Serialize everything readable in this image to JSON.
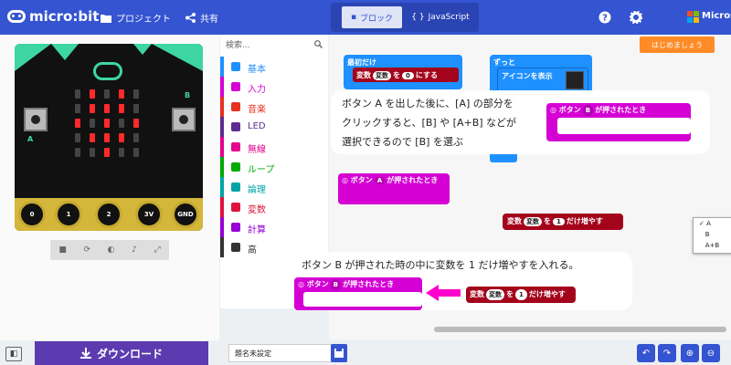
{
  "header": {
    "logo_text": "micro:bit",
    "project_label": "プロジェクト",
    "share_label": "共有",
    "blocks_label": "ブロック",
    "javascript_label": "JavaScript",
    "microsoft_label": "Microsoft",
    "colors": {
      "bar": "#3454d1"
    }
  },
  "simulator": {
    "button_a": "A",
    "button_b": "B",
    "pins": [
      "0",
      "1",
      "2",
      "3V",
      "GND"
    ]
  },
  "toolbox": {
    "search_placeholder": "検索...",
    "categories": [
      {
        "label": "基本",
        "color": "#1e90ff",
        "icon": "grid-icon"
      },
      {
        "label": "入力",
        "color": "#d400d4",
        "icon": "circle-icon"
      },
      {
        "label": "音楽",
        "color": "#e63022",
        "icon": "headphones-icon"
      },
      {
        "label": "LED",
        "color": "#5c2d91",
        "icon": "toggle-icon"
      },
      {
        "label": "無線",
        "color": "#e3008c",
        "icon": "signal-icon"
      },
      {
        "label": "ループ",
        "color": "#00aa00",
        "icon": "refresh-icon"
      },
      {
        "label": "論理",
        "color": "#00a4a6",
        "icon": "shuffle-icon"
      },
      {
        "label": "変数",
        "color": "#dc143c",
        "icon": "list-icon"
      },
      {
        "label": "計算",
        "color": "#9400d3",
        "icon": "calculator-icon"
      },
      {
        "label": "高",
        "color": "#333333",
        "icon": "chevron-down-icon"
      }
    ]
  },
  "workspace": {
    "start_tutorial": "はじめましょう",
    "on_start": {
      "title": "最初だけ",
      "var_label": "変数",
      "var_name": "変数",
      "to": "を",
      "value": "0",
      "set_to": "にする"
    },
    "forever": {
      "title": "ずっと",
      "show_icon": "アイコンを表示"
    },
    "button_block_top": {
      "prefix": "ボタン",
      "button": "B",
      "suffix": "が押されたとき"
    },
    "button_block_mid": {
      "prefix": "ボタン",
      "button": "A",
      "suffix": "が押されたとき"
    },
    "dropdown": [
      "A",
      "B",
      "A+B"
    ],
    "change_var": {
      "var_label": "変数",
      "var_name": "変数",
      "to": "を",
      "value": "1",
      "suffix": "だけ増やす"
    },
    "button_block_bottom": {
      "prefix": "ボタン",
      "button": "B",
      "suffix": "が押されたとき"
    },
    "change_var_bottom": {
      "var_label": "変数",
      "var_name": "変数",
      "to": "を",
      "value": "1",
      "suffix": "だけ増やす"
    }
  },
  "callouts": {
    "top_line1": "ボタン A を出した後に、[A] の部分を",
    "top_line2": "クリックすると、[B] や [A+B] などが",
    "top_line3": "選択できるので [B] を選ぶ",
    "bottom": "ボタン B が押された時の中に変数を 1 だけ増やすを入れる。"
  },
  "footer": {
    "download_label": "ダウンロード",
    "filename": "題名未設定"
  }
}
